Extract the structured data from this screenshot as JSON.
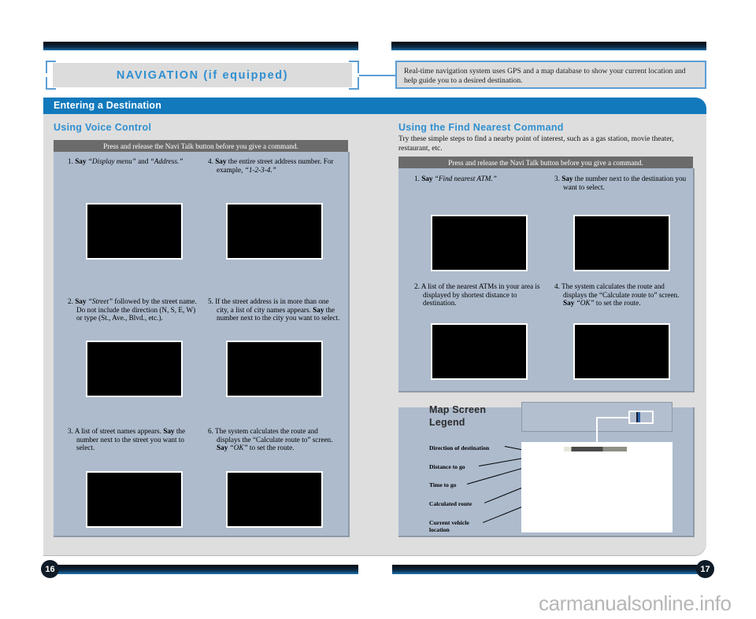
{
  "header": {
    "chapter_title": "NAVIGATION (if equipped)",
    "description": "Real-time navigation system uses GPS and a map database to show your current location and help guide you to a desired destination."
  },
  "panel": {
    "bar_title": "Entering a Destination"
  },
  "left_section": {
    "title": "Using Voice Control",
    "grey_bar": "Press and release the Navi Talk button before you give a command.",
    "steps": [
      {
        "num": "1.",
        "html": "<b>Say</b> <i>“Display menu”</i> and <i>“Address.”</i>"
      },
      {
        "num": "2.",
        "html": "<b>Say</b> <i>“Street”</i> followed by the street name. Do not include the direction (N, S, E, W) or type (St., Ave., Blvd., etc.)."
      },
      {
        "num": "3.",
        "html": "A list of street names appears. <b>Say</b> the number next to the street you want to select."
      },
      {
        "num": "4.",
        "html": "<b>Say</b> the entire street address number. For example, <i>“1-2-3-4.”</i>"
      },
      {
        "num": "5.",
        "html": "If the street address is in more than one city, a list of city names appears. <b>Say</b> the number next to the city you want to select."
      },
      {
        "num": "6.",
        "html": "The system calculates the route and displays the “Calculate route to” screen. <b>Say</b> <i>“OK”</i> to set the route."
      }
    ]
  },
  "right_section": {
    "title": "Using the Find Nearest Command",
    "subtitle": "Try these simple steps to find a nearby point of interest, such as a gas station, movie theater, restaurant, etc.",
    "grey_bar": "Press and release the Navi Talk button before you give a command.",
    "steps": [
      {
        "num": "1.",
        "html": "<b>Say</b> <i>“Find nearest ATM.”</i>"
      },
      {
        "num": "2.",
        "html": "A list of the nearest ATMs in your area is displayed by shortest distance to destination."
      },
      {
        "num": "3.",
        "html": "<b>Say</b> the number next to the destination you want to select."
      },
      {
        "num": "4.",
        "html": "The system calculates the route and displays the “Calculate route to” screen. <b>Say</b> <i>“OK”</i> to set the route."
      }
    ]
  },
  "legend": {
    "title_line1": "Map Screen",
    "title_line2": "Legend",
    "labels": [
      "Direction of destination",
      "Distance to go",
      "Time to go",
      "Calculated route",
      "Current vehicle location"
    ]
  },
  "footer": {
    "page_left": "16",
    "page_right": "17",
    "watermark": "carmanualsonline.info"
  },
  "colors": {
    "accent_blue": "#2f8fd0",
    "bar_blue": "#1279bc",
    "panel_grey": "#dedede",
    "steel_blue": "#adbbcd",
    "grey_bar": "#6b6b6b"
  }
}
